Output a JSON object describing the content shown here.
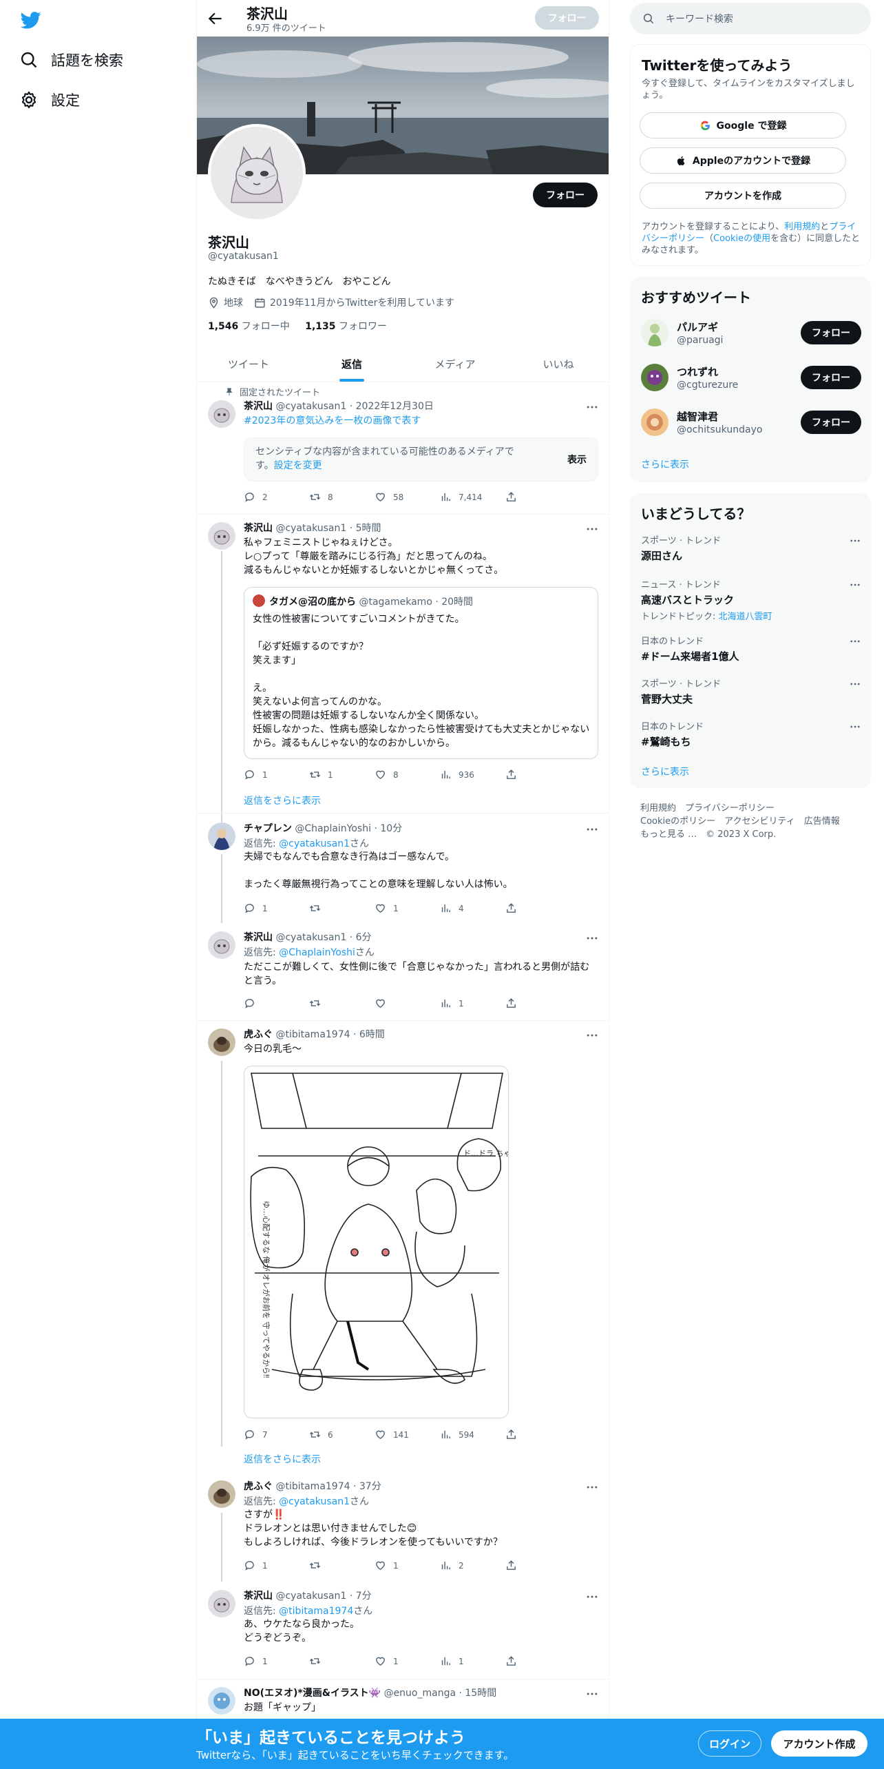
{
  "nav": {
    "search_label": "話題を検索",
    "settings_label": "設定"
  },
  "topbar": {
    "name": "茶沢山",
    "tweet_count": "6.9万 件のツイート",
    "follow": "フォロー"
  },
  "profile": {
    "name": "茶沢山",
    "handle": "@cyatakusan1",
    "bio": "たぬきそば　なべやきうどん　おやこどん",
    "location": "地球",
    "joined": "2019年11月からTwitterを利用しています",
    "following_count": "1,546",
    "following_label": "フォロー中",
    "followers_count": "1,135",
    "followers_label": "フォロワー",
    "follow": "フォロー"
  },
  "tabs": [
    "ツイート",
    "返信",
    "メディア",
    "いいね"
  ],
  "tweets": [
    {
      "pinned": "固定されたツイート",
      "name": "茶沢山",
      "meta": "@cyatakusan1 · 2022年12月30日",
      "text": "#2023年の意気込みを一枚の画像で表す",
      "sensitive": "センシティブな内容が含まれている可能性のあるメディアです。",
      "sensitive_link": "設定を変更",
      "show": "表示",
      "replies": "2",
      "retweets": "8",
      "likes": "58",
      "views": "7,414"
    },
    {
      "name": "茶沢山",
      "meta": "@cyatakusan1 · 5時間",
      "text": "私ゃフェミニストじゃねぇけどさ。\nレ○プって「尊厳を踏みにじる行為」だと思ってんのね。\n減るもんじゃないとか妊娠するしないとかじゃ無くってさ。",
      "quote": {
        "name": "タガメ@沼の底から",
        "meta": "@tagamekamo · 20時間",
        "text": "女性の性被害についてすごいコメントがきてた。\n\n「必ず妊娠するのですか？\n笑えます」\n\nえ。\n笑えないよ何言ってんのかな。\n性被害の問題は妊娠するしないなんか全く関係ない。\n妊娠しなかった、性病も感染しなかったら性被害受けても大丈夫とかじゃないから。減るもんじゃない的なのおかしいから。"
      },
      "replies": "1",
      "retweets": "1",
      "likes": "8",
      "views": "936"
    },
    {
      "name": "チャプレン",
      "meta": "@ChaplainYoshi · 10分",
      "reply_prefix": "返信先: ",
      "reply_to": "@cyatakusan1",
      "reply_suffix": "さん",
      "text": "夫婦でもなんでも合意なき行為はゴー感なんで。\n\nまったく尊厳無視行為ってことの意味を理解しない人は怖い。",
      "replies": "1",
      "retweets": "",
      "likes": "1",
      "views": "4"
    },
    {
      "name": "茶沢山",
      "meta": "@cyatakusan1 · 6分",
      "reply_prefix": "返信先: ",
      "reply_to": "@ChaplainYoshi",
      "reply_suffix": "さん",
      "text": "ただここが難しくて、女性側に後で「合意じゃなかった」言われると男側が詰むと言う。",
      "replies": "",
      "retweets": "",
      "likes": "",
      "views": "1"
    },
    {
      "name": "虎ふぐ",
      "meta": "@tibitama1974 · 6時間",
      "text": "今日の乳毛〜",
      "replies": "7",
      "retweets": "6",
      "likes": "141",
      "views": "594"
    },
    {
      "name": "虎ふぐ",
      "meta": "@tibitama1974 · 37分",
      "reply_prefix": "返信先: ",
      "reply_to": "@cyatakusan1",
      "reply_suffix": "さん",
      "text": "さすが‼️\nドラレオンとは思い付きませんでした😊\nもしよろしければ、今後ドラレオンを使ってもいいですか？",
      "replies": "1",
      "retweets": "",
      "likes": "1",
      "views": "2"
    },
    {
      "name": "茶沢山",
      "meta": "@cyatakusan1 · 7分",
      "reply_prefix": "返信先: ",
      "reply_to": "@tibitama1974",
      "reply_suffix": "さん",
      "text": "あ、ウケたなら良かった。\nどうぞどうぞ。",
      "replies": "1",
      "retweets": "",
      "likes": "1",
      "views": "1"
    },
    {
      "name": "NO(エヌオ)*漫画&イラスト👾",
      "meta": "@enuo_manga · 15時間",
      "text": "お題「ギャップ」"
    }
  ],
  "show_more_replies": "返信をさらに表示",
  "manga_text": {
    "bubble1": "ゆ…心配するな 俺が オレがお前を 守ってやるから‼",
    "bubble2": "ド…ドラ ちゃん…"
  },
  "right": {
    "search_placeholder": "キーワード検索",
    "signup": {
      "title": "Twitterを使ってみよう",
      "subtitle": "今すぐ登録して、タイムラインをカスタマイズしましょう。",
      "google": "Google で登録",
      "apple": "Appleのアカウントで登録",
      "create": "アカウントを作成",
      "legal_pre": "アカウントを登録することにより、",
      "legal_terms": "利用規約",
      "legal_and": "と",
      "legal_privacy": "プライバシーポリシー",
      "legal_mid": "（",
      "legal_cookie": "Cookieの使用",
      "legal_post": "を含む）に同意したとみなされます。"
    },
    "recommend": {
      "title": "おすすめツイート",
      "users": [
        {
          "name": "パルアギ",
          "handle": "@paruagi"
        },
        {
          "name": "つれずれ",
          "handle": "@cgturezure"
        },
        {
          "name": "越智津君",
          "handle": "@ochitsukundayo"
        }
      ],
      "follow": "フォロー",
      "more": "さらに表示"
    },
    "trends": {
      "title": "いまどうしてる？",
      "items": [
        {
          "cat": "スポーツ · トレンド",
          "name": "源田さん",
          "sub": ""
        },
        {
          "cat": "ニュース · トレンド",
          "name": "高速バスとトラック",
          "sub": "トレンドトピック: ",
          "sub_link": "北海道八雲町"
        },
        {
          "cat": "日本のトレンド",
          "name": "#ドーム来場者1億人",
          "sub": ""
        },
        {
          "cat": "スポーツ · トレンド",
          "name": "菅野大丈夫",
          "sub": ""
        },
        {
          "cat": "日本のトレンド",
          "name": "#鷲崎もち",
          "sub": ""
        }
      ],
      "more": "さらに表示"
    },
    "footer": {
      "line1": "利用規約　プライバシーポリシー",
      "line2": "Cookieのポリシー　アクセシビリティ　広告情報",
      "line3": "もっと見る …　© 2023 X Corp."
    }
  },
  "bottom": {
    "title": "「いま」起きていることを見つけよう",
    "subtitle": "Twitterなら、「いま」起きていることをいち早くチェックできます。",
    "login": "ログイン",
    "signup": "アカウント作成"
  },
  "colors": {
    "accent": "#1d9bf0",
    "text": "#0f1419",
    "muted": "#536471"
  }
}
